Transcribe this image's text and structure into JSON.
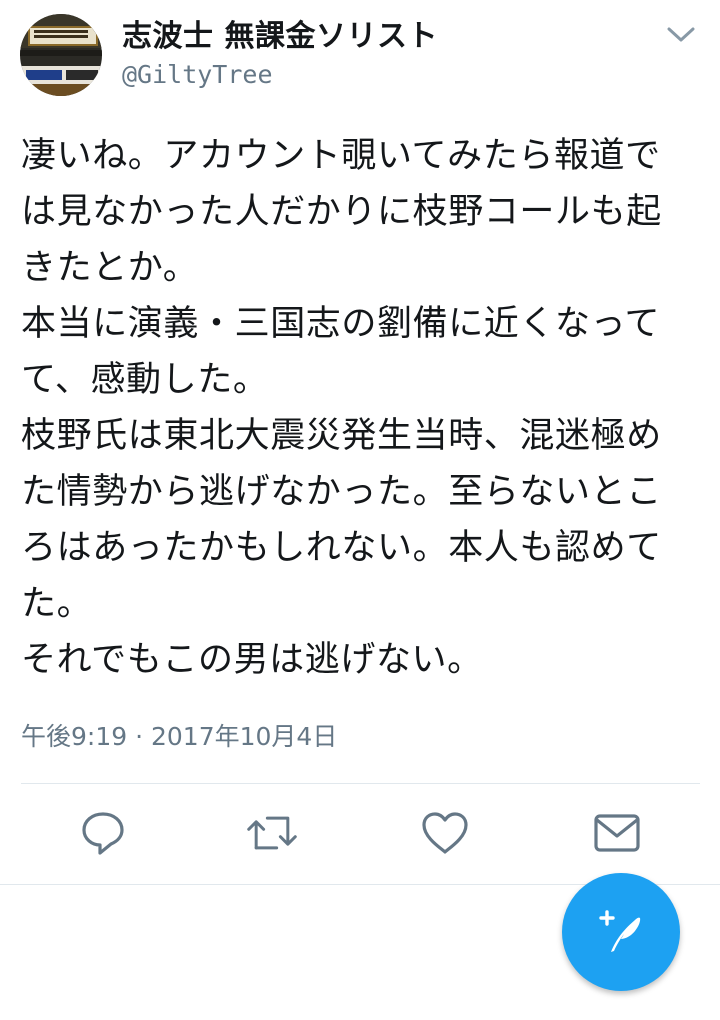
{
  "user": {
    "display_name": "志波士  無課金ソリスト",
    "handle": "@GiltyTree"
  },
  "tweet": {
    "lines": [
      "凄いね。アカウント覗いてみたら報道で",
      "は見なかった人だかりに枝野コールも起",
      "きたとか。",
      "本当に演義・三国志の劉備に近くなって",
      "て、感動した。",
      "枝野氏は東北大震災発生当時、混迷極め",
      "た情勢から逃げなかった。至らないとこ",
      "ろはあったかもしれない。本人も認めて",
      "た。",
      "それでもこの男は逃げない。"
    ],
    "timestamp": "午後9:19 · 2017年10月4日"
  },
  "actions": {
    "reply_icon": "reply-icon",
    "retweet_icon": "retweet-icon",
    "like_icon": "heart-icon",
    "dm_icon": "envelope-icon"
  },
  "compose": {
    "icon": "compose-feather-icon"
  },
  "colors": {
    "accent": "#1da1f2",
    "secondary_text": "#657786",
    "icon_gray": "#657786",
    "divider": "#e1e8ed"
  }
}
